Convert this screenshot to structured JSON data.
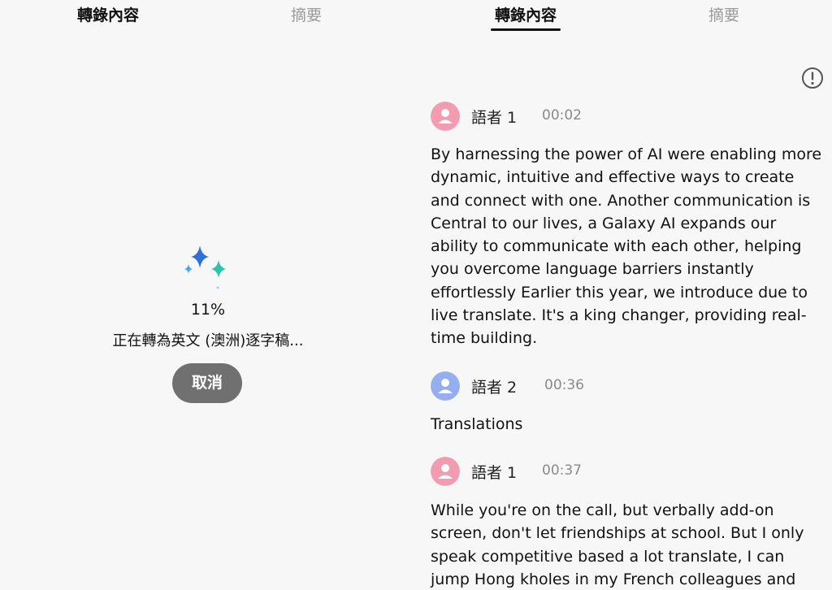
{
  "left_pane": {
    "tabs": [
      {
        "label": "轉錄內容",
        "active": true
      },
      {
        "label": "摘要",
        "active": false
      }
    ],
    "progress": {
      "percent_text": "11%",
      "percent_value": 11,
      "status_text": "正在轉為英文 (澳洲)逐字稿...",
      "cancel_label": "取消"
    }
  },
  "right_pane": {
    "tabs": [
      {
        "label": "轉錄內容",
        "active": true
      },
      {
        "label": "摘要",
        "active": false
      }
    ],
    "info_icon": "info-circle-icon",
    "entries": [
      {
        "speaker": "語者 1",
        "time": "00:02",
        "avatar_color": "#f29bb1",
        "text": "By harnessing the power of AI were enabling more dynamic, intuitive and effective ways to create and connect with one. Another communication is Central to our lives, a Galaxy AI expands our ability to communicate with each other, helping you overcome language barriers instantly effortlessly Earlier this year, we introduce due to live translate. It's a king changer, providing real-time building."
      },
      {
        "speaker": "語者 2",
        "time": "00:36",
        "avatar_color": "#94aef0",
        "text": "Translations"
      },
      {
        "speaker": "語者 1",
        "time": "00:37",
        "avatar_color": "#f29bb1",
        "text": "While you're on the call, but verbally add-on screen, don't let friendships at school. But I only speak competitive based a lot translate, I can jump Hong kholes in my French colleagues and"
      }
    ]
  },
  "colors": {
    "background": "#f7f7f7",
    "cancel_button": "#707070",
    "sparkle_blue": "#2f6fd6",
    "sparkle_teal": "#2cc4a8"
  }
}
